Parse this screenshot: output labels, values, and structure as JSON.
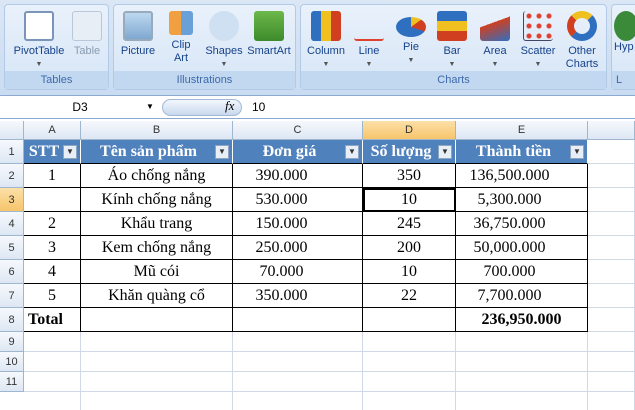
{
  "ribbon": {
    "groups": [
      {
        "label": "Tables",
        "buttons": [
          "PivotTable",
          "Table"
        ]
      },
      {
        "label": "Illustrations",
        "buttons": [
          "Picture",
          "Clip Art",
          "Shapes",
          "SmartArt"
        ]
      },
      {
        "label": "Charts",
        "buttons": [
          "Column",
          "Line",
          "Pie",
          "Bar",
          "Area",
          "Scatter",
          "Other Charts"
        ]
      },
      {
        "label": "L",
        "buttons": [
          "Hyp"
        ]
      }
    ]
  },
  "formula_bar": {
    "name_box": "D3",
    "fx": "fx",
    "value": "10"
  },
  "columns": [
    "A",
    "B",
    "C",
    "D",
    "E"
  ],
  "rows": [
    "1",
    "2",
    "3",
    "4",
    "5",
    "6",
    "7",
    "8",
    "9",
    "10",
    "11"
  ],
  "table": {
    "headers": [
      "STT",
      "Tên sản phẩm",
      "Đơn giá",
      "Số lượng",
      "Thành tiền"
    ],
    "rows": [
      [
        "1",
        "Áo chống nắng",
        "390.000",
        "350",
        "136,500.000"
      ],
      [
        "",
        "Kính chống nắng",
        "530.000",
        "10",
        "5,300.000"
      ],
      [
        "2",
        "Khẩu trang",
        "150.000",
        "245",
        "36,750.000"
      ],
      [
        "3",
        "Kem chống nắng",
        "250.000",
        "200",
        "50,000.000"
      ],
      [
        "4",
        "Mũ cói",
        "70.000",
        "10",
        "700.000"
      ],
      [
        "5",
        "Khăn quàng cổ",
        "350.000",
        "22",
        "7,700.000"
      ]
    ],
    "total_label": "Total",
    "total_value": "236,950.000"
  },
  "colors": {
    "header": "#4f81bd",
    "selected": "#f7c56b"
  }
}
